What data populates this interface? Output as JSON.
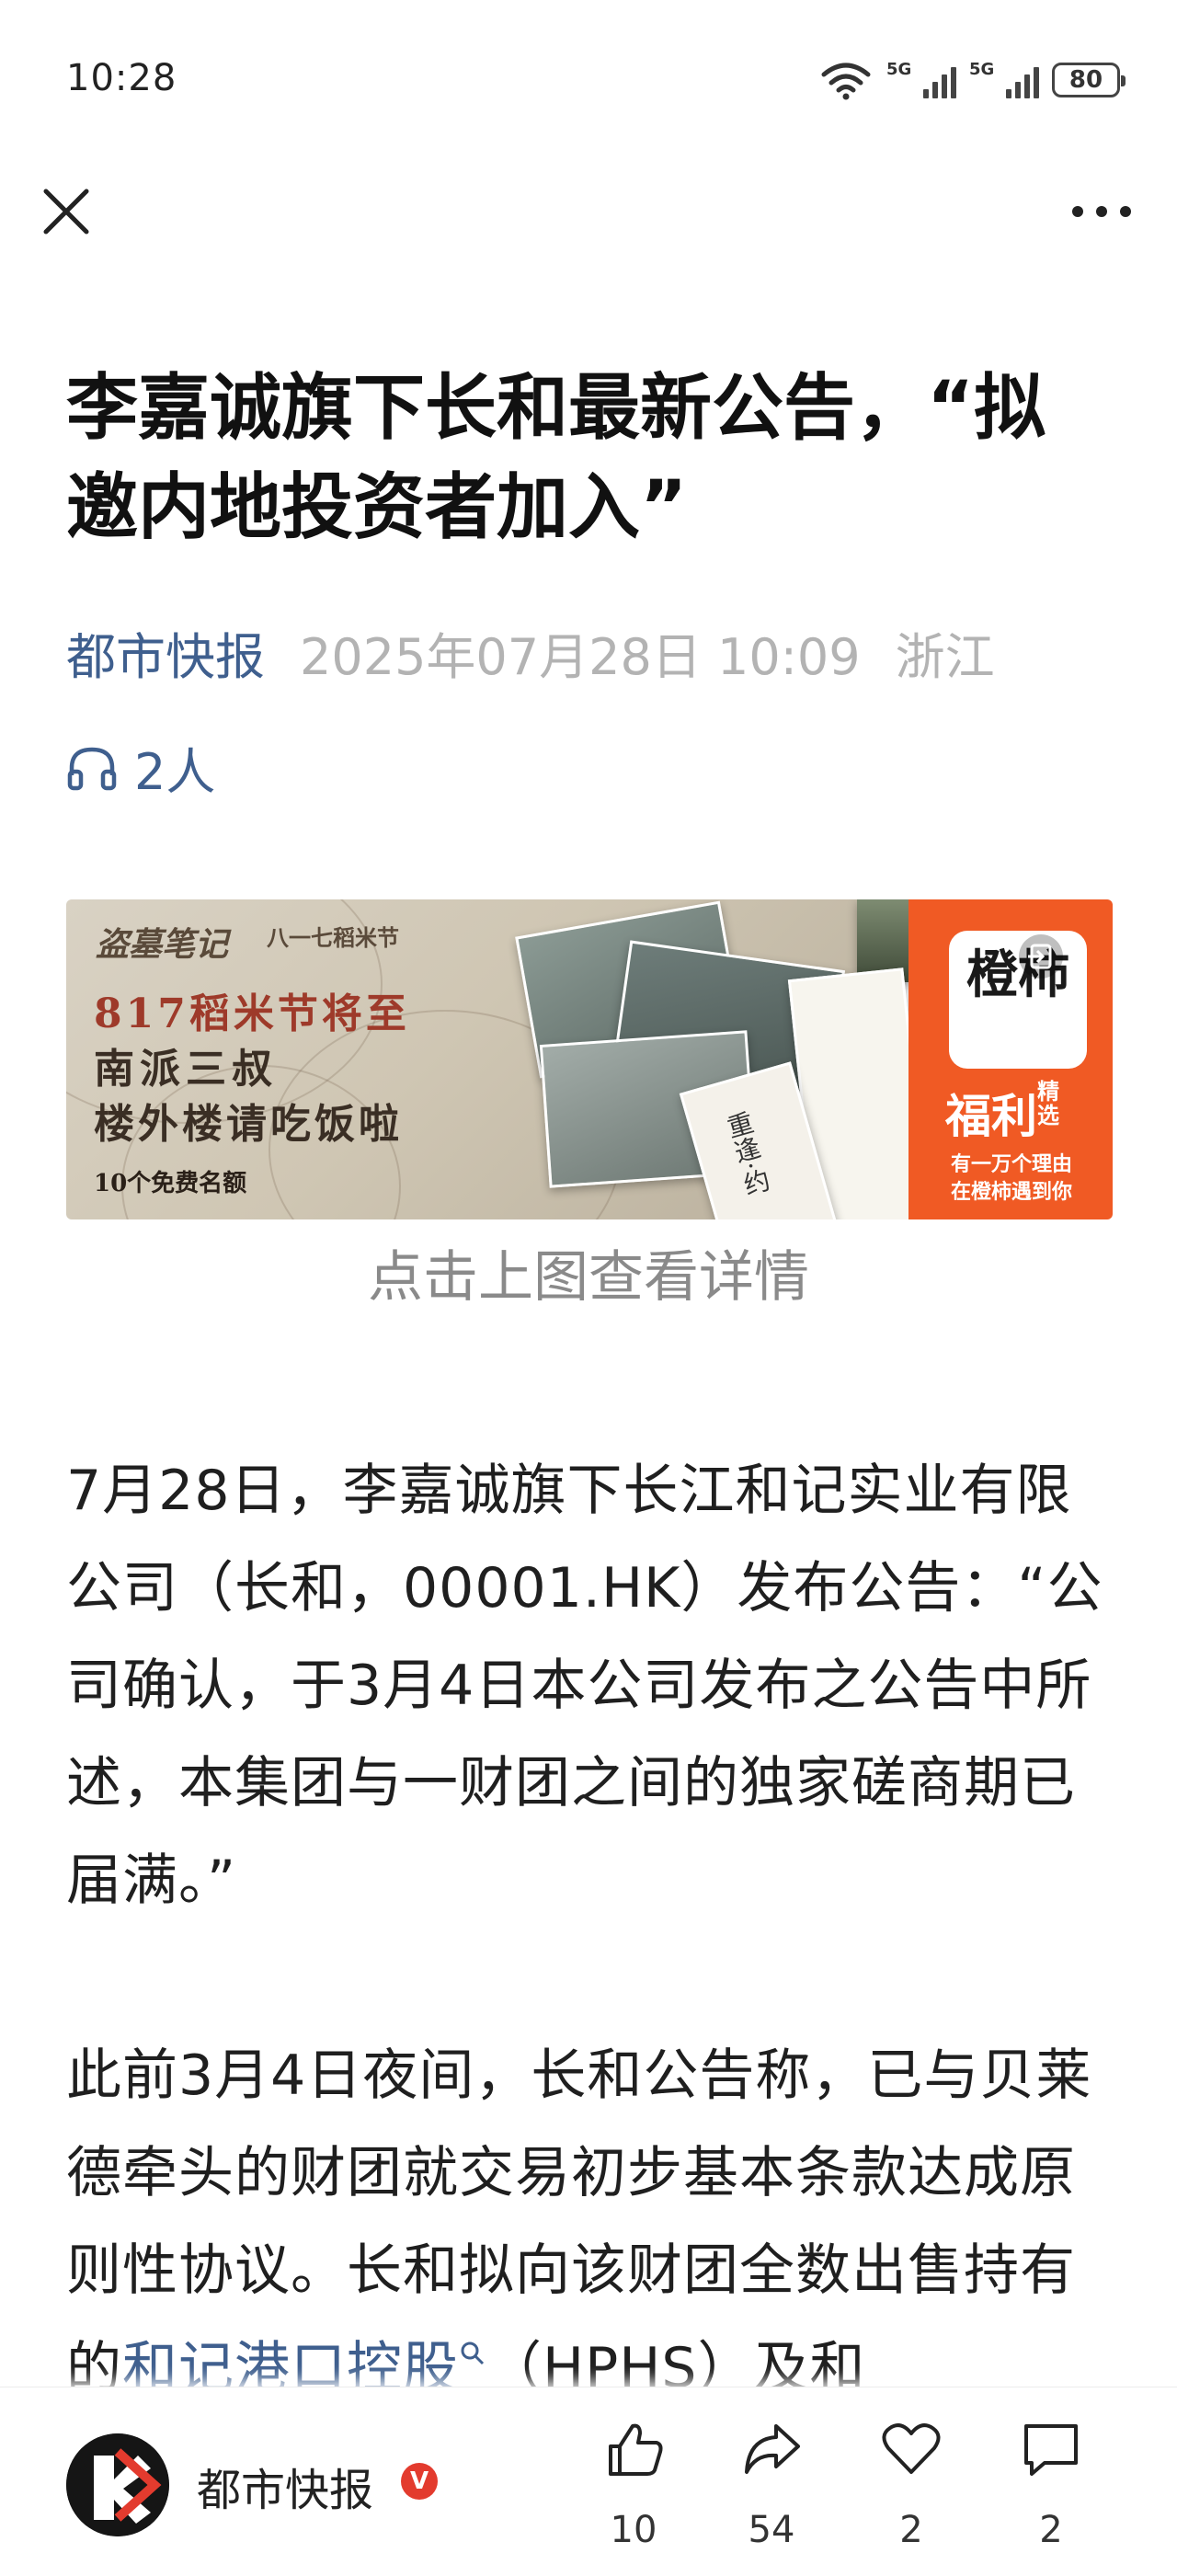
{
  "status_bar": {
    "time": "10:28",
    "network_1": "5G",
    "network_2": "5G",
    "battery": "80"
  },
  "header": {
    "close_icon": "close-icon",
    "more_icon": "more-icon"
  },
  "article": {
    "title": "李嘉诚旗下长和最新公告，“拟邀内地投资者加入”",
    "source": "都市快报",
    "date": "2025年07月28日 10:09",
    "location": "浙江",
    "listeners": "2人",
    "image_caption": "点击上图查看详情",
    "paragraph1": "7月28日，李嘉诚旗下长江和记实业有限公司（长和，00001.HK）发布公告：“公司确认，于3月4日本公司发布之公告中所述，本集团与一财团之间的独家磋商期已届满。”",
    "paragraph2_before": "此前3月4日夜间，长和公告称，已与贝莱德牵头的财团就交易初步基本条款达成原则性协议。长和拟向该财团全数出售持有的",
    "paragraph2_link": "和记港口控股",
    "paragraph2_after": "（HPHS）及和"
  },
  "banner": {
    "brand": "盗墓笔记",
    "brand_sub": "八一七稻米节",
    "line1": "817稻米节将至",
    "line2": "南派三叔",
    "line3": "楼外楼请吃饭啦",
    "line4": "10个免费名额",
    "card_text": "重逢·约",
    "side_logo": "橙柿",
    "side_title": "福利",
    "side_title_small": "精选",
    "side_line1": "有一万个理由",
    "side_line2": "在橙柿遇到你"
  },
  "bottom_bar": {
    "account_name": "都市快报",
    "verified_badge": "V",
    "likes": "10",
    "shares": "54",
    "favorites": "2",
    "comments": "2"
  }
}
